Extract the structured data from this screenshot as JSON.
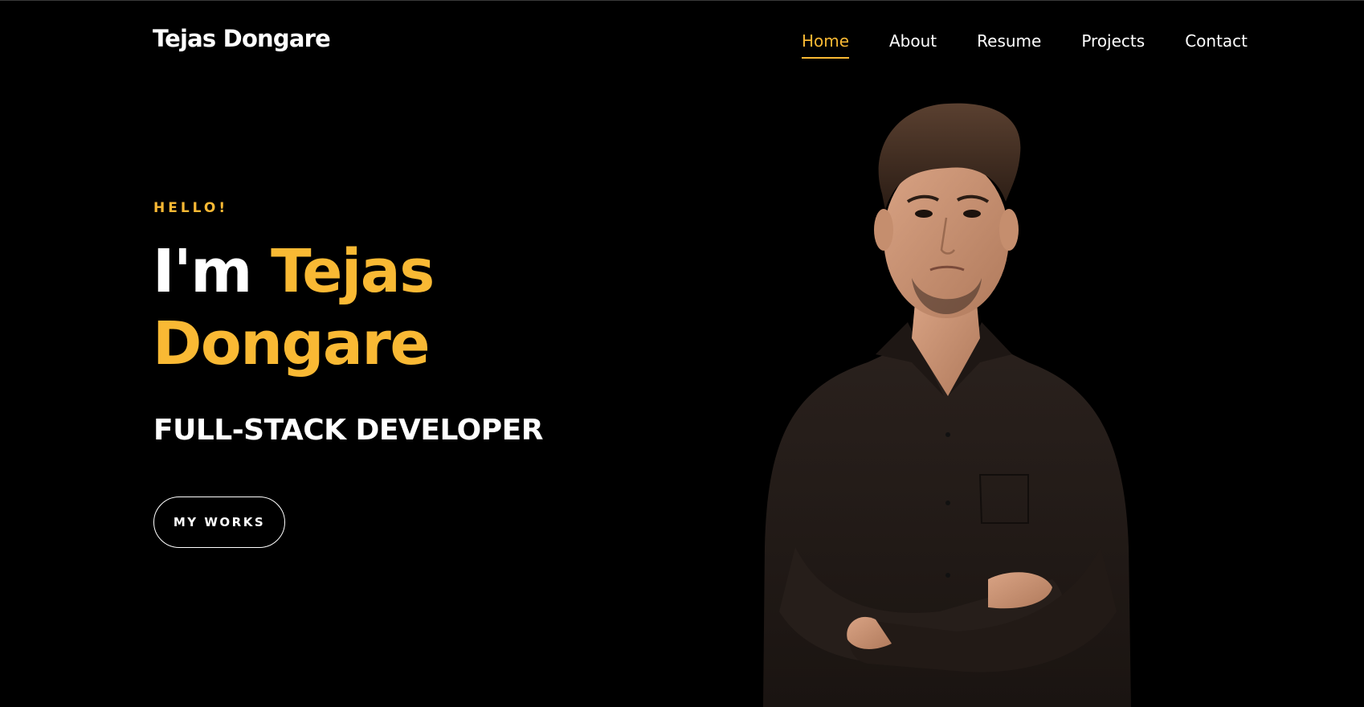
{
  "header": {
    "brand": "Tejas Dongare",
    "nav": [
      {
        "label": "Home",
        "active": true
      },
      {
        "label": "About",
        "active": false
      },
      {
        "label": "Resume",
        "active": false
      },
      {
        "label": "Projects",
        "active": false
      },
      {
        "label": "Contact",
        "active": false
      }
    ]
  },
  "hero": {
    "greeting": "HELLO!",
    "intro": "I'm ",
    "name": "Tejas Dongare",
    "role": "FULL-STACK DEVELOPER",
    "cta_label": "MY WORKS"
  },
  "colors": {
    "accent": "#f9b934",
    "background": "#000000",
    "text": "#ffffff"
  }
}
